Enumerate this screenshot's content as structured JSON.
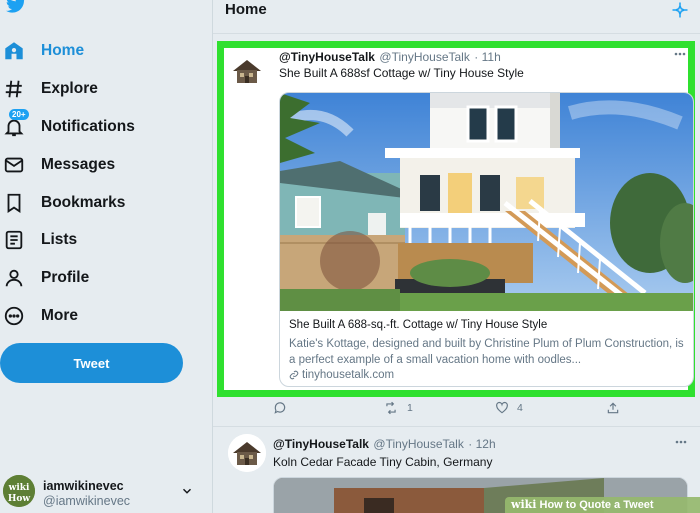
{
  "sidebar": {
    "items": [
      {
        "label": "Home",
        "icon": "home-icon"
      },
      {
        "label": "Explore",
        "icon": "hashtag-icon"
      },
      {
        "label": "Notifications",
        "icon": "bell-icon",
        "badge": "20+"
      },
      {
        "label": "Messages",
        "icon": "envelope-icon"
      },
      {
        "label": "Bookmarks",
        "icon": "bookmark-icon"
      },
      {
        "label": "Lists",
        "icon": "list-icon"
      },
      {
        "label": "Profile",
        "icon": "person-icon"
      },
      {
        "label": "More",
        "icon": "more-circle-icon"
      }
    ],
    "tweet_button": "Tweet",
    "account": {
      "name": "iamwikinevec",
      "handle": "@iamwikinevec",
      "avatar_text": "wiki How"
    }
  },
  "header": {
    "title": "Home"
  },
  "tweets": [
    {
      "name": "@TinyHouseTalk",
      "handle": "@TinyHouseTalk",
      "time": "· 11h",
      "text": "She Built A 688sf Cottage w/ Tiny House Style",
      "card": {
        "title": "She Built A 688-sq.-ft. Cottage w/ Tiny House Style",
        "description": "Katie's Kottage, designed and built by Christine Plum of Plum Construction, is a perfect example of a small vacation home with oodles...",
        "url": "tinyhousetalk.com"
      },
      "actions": {
        "reply_count": "",
        "retweet_count": "1",
        "like_count": "4"
      }
    },
    {
      "name": "@TinyHouseTalk",
      "handle": "@TinyHouseTalk",
      "time": "· 12h",
      "text": "Koln Cedar Facade Tiny Cabin, Germany"
    }
  ],
  "watermark": {
    "brand": "wiki",
    "text": "How to Quote a Tweet"
  },
  "colors": {
    "accent": "#1d8fd8",
    "highlight": "#2fe02f",
    "background": "#e6ecf0"
  }
}
